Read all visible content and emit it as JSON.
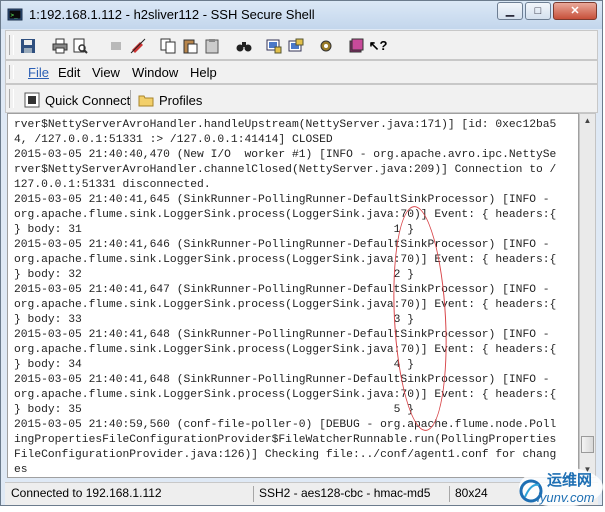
{
  "window": {
    "title": "1:192.168.1.112 - h2sliver112 - SSH Secure Shell"
  },
  "title_buttons": {
    "minimize": "▁",
    "maximize": "□",
    "close": "✕"
  },
  "toolbar": {
    "buttons": [
      "save-icon",
      "print-icon",
      "print-preview-icon",
      "disconnect-icon",
      "reconnect-icon",
      "copy-icon",
      "paste-icon",
      "clipboard-icon",
      "find-icon",
      "file-transfer-icon",
      "new-window-icon",
      "settings-icon",
      "help-icon",
      "context-help-icon"
    ]
  },
  "menu": {
    "items": [
      "File",
      "Edit",
      "View",
      "Window",
      "Help"
    ]
  },
  "quickbar": {
    "quick_connect": "Quick Connect",
    "profiles": "Profiles"
  },
  "terminal": {
    "lines": [
      "rver$NettyServerAvroHandler.handleUpstream(NettyServer.java:171)] [id: 0xec12ba5",
      "4, /127.0.0.1:51331 :> /127.0.0.1:41414] CLOSED",
      "2015-03-05 21:40:40,470 (New I/O  worker #1) [INFO - org.apache.avro.ipc.NettySe",
      "rver$NettyServerAvroHandler.channelClosed(NettyServer.java:209)] Connection to /",
      "127.0.0.1:51331 disconnected.",
      "2015-03-05 21:40:41,645 (SinkRunner-PollingRunner-DefaultSinkProcessor) [INFO -",
      "org.apache.flume.sink.LoggerSink.process(LoggerSink.java:70)] Event: { headers:{",
      "} body: 31                                              1 }",
      "2015-03-05 21:40:41,646 (SinkRunner-PollingRunner-DefaultSinkProcessor) [INFO -",
      "org.apache.flume.sink.LoggerSink.process(LoggerSink.java:70)] Event: { headers:{",
      "} body: 32                                              2 }",
      "2015-03-05 21:40:41,647 (SinkRunner-PollingRunner-DefaultSinkProcessor) [INFO -",
      "org.apache.flume.sink.LoggerSink.process(LoggerSink.java:70)] Event: { headers:{",
      "} body: 33                                              3 }",
      "2015-03-05 21:40:41,648 (SinkRunner-PollingRunner-DefaultSinkProcessor) [INFO -",
      "org.apache.flume.sink.LoggerSink.process(LoggerSink.java:70)] Event: { headers:{",
      "} body: 34                                              4 }",
      "2015-03-05 21:40:41,648 (SinkRunner-PollingRunner-DefaultSinkProcessor) [INFO -",
      "org.apache.flume.sink.LoggerSink.process(LoggerSink.java:70)] Event: { headers:{",
      "} body: 35                                              5 }",
      "2015-03-05 21:40:59,560 (conf-file-poller-0) [DEBUG - org.apache.flume.node.Poll",
      "ingPropertiesFileConfigurationProvider$FileWatcherRunnable.run(PollingProperties",
      "FileConfigurationProvider.java:126)] Checking file:../conf/agent1.conf for chang",
      "es"
    ]
  },
  "status": {
    "connection": "Connected to 192.168.1.112",
    "encryption": "SSH2 - aes128-cbc - hmac-md5",
    "size": "80x24"
  },
  "watermark": {
    "text_cn": "运维网",
    "text_url": "iyunv.com"
  },
  "colors": {
    "annotation_red": "#d8464a",
    "accent_blue": "#2b5fb5"
  }
}
